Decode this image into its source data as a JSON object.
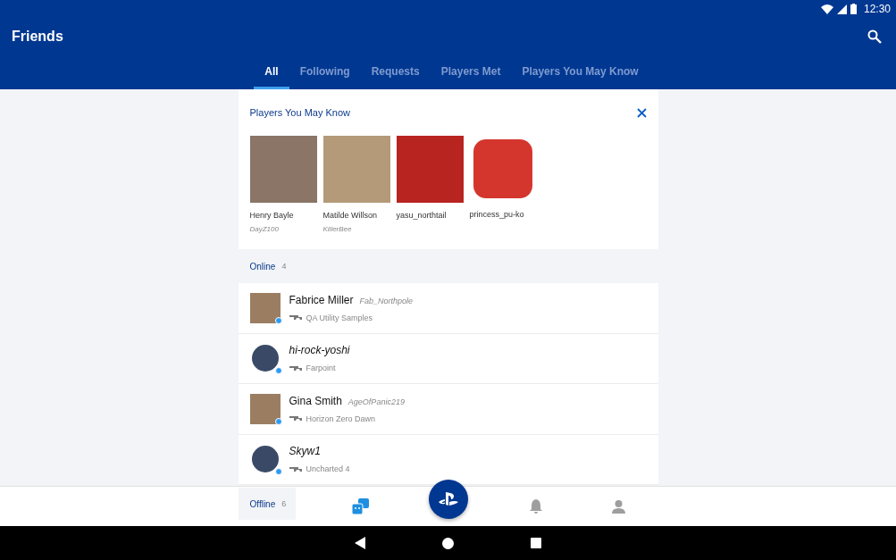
{
  "status_bar": {
    "time": "12:30"
  },
  "app_bar": {
    "title": "Friends"
  },
  "tabs": [
    {
      "label": "All",
      "selected": true
    },
    {
      "label": "Following",
      "selected": false
    },
    {
      "label": "Requests",
      "selected": false
    },
    {
      "label": "Players Met",
      "selected": false
    },
    {
      "label": "Players You May Know",
      "selected": false
    }
  ],
  "suggestions": {
    "title": "Players You May Know",
    "players": [
      {
        "name": "Henry Bayle",
        "online_id": "DayZ100"
      },
      {
        "name": "Matilde Willson",
        "online_id": "KillerBee"
      },
      {
        "name": "yasu_northtail"
      },
      {
        "name": "princess_pu-ko"
      }
    ]
  },
  "online": {
    "label": "Online",
    "count": "4",
    "friends": [
      {
        "kind": "real_name",
        "name": "Fabrice Miller",
        "online_id": "Fab_Northpole",
        "game": "QA Utility Samples"
      },
      {
        "kind": "online_id",
        "name": "hi-rock-yoshi",
        "game": "Farpoint"
      },
      {
        "kind": "real_name",
        "name": "Gina Smith",
        "online_id": "AgeOfPanic219",
        "game": "Horizon Zero Dawn"
      },
      {
        "kind": "online_id",
        "name": "Skyw1",
        "game": "Uncharted 4"
      }
    ]
  },
  "offline": {
    "label": "Offline",
    "count": "6"
  },
  "bottom_nav": [
    {
      "kind": "friends",
      "selected": true
    },
    {
      "kind": "playstation",
      "selected": false
    },
    {
      "kind": "notifications",
      "selected": false
    },
    {
      "kind": "profile",
      "selected": false
    }
  ]
}
